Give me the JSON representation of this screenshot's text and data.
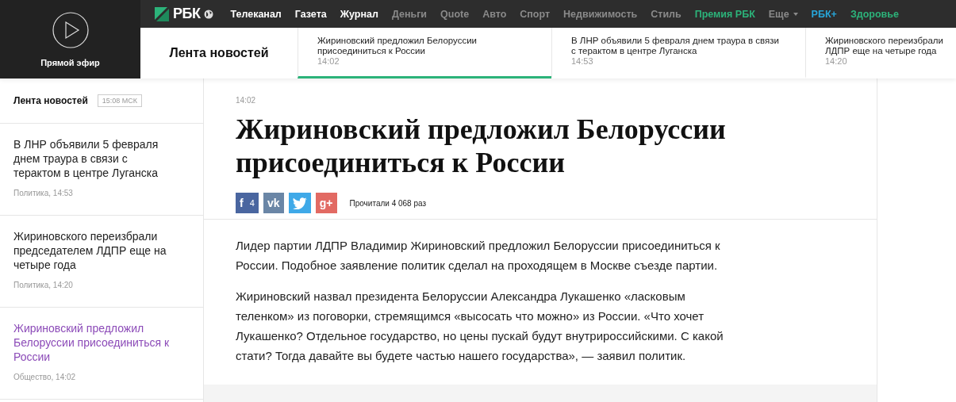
{
  "live": {
    "label": "Прямой эфир"
  },
  "logo": {
    "text": "РБК"
  },
  "nav": [
    {
      "label": "Телеканал",
      "color": "#ffffff"
    },
    {
      "label": "Газета",
      "color": "#ffffff"
    },
    {
      "label": "Журнал",
      "color": "#ffffff"
    },
    {
      "label": "Деньги",
      "color": "#8a8a8a"
    },
    {
      "label": "Quote",
      "color": "#8a8a8a"
    },
    {
      "label": "Авто",
      "color": "#8a8a8a"
    },
    {
      "label": "Спорт",
      "color": "#8a8a8a"
    },
    {
      "label": "Недвижимость",
      "color": "#8a8a8a"
    },
    {
      "label": "Стиль",
      "color": "#8a8a8a"
    },
    {
      "label": "Премия РБК",
      "color": "#2cb37a"
    },
    {
      "label": "Еще",
      "color": "#8a8a8a",
      "dropdown": true
    },
    {
      "label": "РБК+",
      "color": "#27a6d9"
    },
    {
      "label": "Здоровье",
      "color": "#2cb37a"
    }
  ],
  "ticker": {
    "title": "Лента новостей",
    "items": [
      {
        "lines": [
          "Жириновский предложил Белоруссии",
          "присоединиться к России"
        ],
        "time": "14:02",
        "selected": true
      },
      {
        "lines": [
          "В ЛНР объявили 5 февраля днем траура в связи",
          "с терактом в центре Луганска"
        ],
        "time": "14:53",
        "selected": false
      },
      {
        "lines": [
          "Жириновского переизбрали",
          "ЛДПР еще на четыре года"
        ],
        "time": "14:20",
        "selected": false
      }
    ]
  },
  "sidebar": {
    "title": "Лента новостей",
    "clock": "15:08 МСК",
    "items": [
      {
        "headline": "В ЛНР объявили 5 февраля днем траура в связи с терактом в центре Луганска",
        "meta": "Политика, 14:53",
        "selected": false
      },
      {
        "headline": "Жириновского переизбрали председателем ЛДПР еще на четыре года",
        "meta": "Политика, 14:20",
        "selected": false
      },
      {
        "headline": "Жириновский предложил Белоруссии присоединиться к России",
        "meta": "Общество, 14:02",
        "selected": true
      }
    ]
  },
  "article": {
    "time": "14:02",
    "title": "Жириновский предложил Белоруссии присоединиться к России",
    "share": [
      {
        "kind": "facebook",
        "glyph": "f",
        "count": "4"
      },
      {
        "kind": "vk",
        "glyph": "vk"
      },
      {
        "kind": "twitter"
      },
      {
        "kind": "googleplus",
        "glyph": "g+"
      }
    ],
    "views": "Прочитали 4 068 раз",
    "paragraphs": [
      "Лидер партии ЛДПР Владимир Жириновский предложил Белоруссии присоединиться к России. Подобное заявление политик сделал на проходящем в Москве съезде партии.",
      "Жириновский назвал президента Белоруссии Александра Лукашенко «ласковым теленком» из поговорки, стремящимся «высосать что можно» из России. «Что хочет Лукашенко? Отдельное государство, но цены пускай будут внутрироссийскими. С какой стати? Тогда давайте вы будете частью нашего государства», — заявил политик."
    ]
  }
}
